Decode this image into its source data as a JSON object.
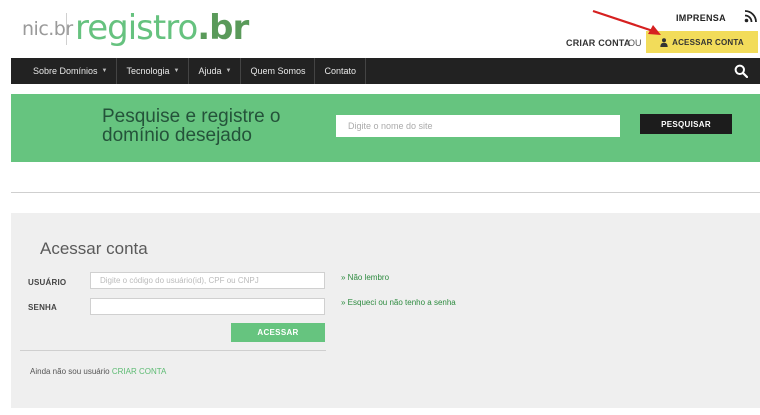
{
  "header": {
    "logo_nic": "nic.br",
    "logo_registro": "registro",
    "logo_br": ".br",
    "imprensa": "IMPRENSA",
    "criar_conta": "CRIAR CONTA",
    "ou": "OU",
    "acessar_conta": "ACESSAR CONTA"
  },
  "nav": {
    "items": [
      {
        "label": "Sobre Domínios",
        "caret": "▼"
      },
      {
        "label": "Tecnologia",
        "caret": "▼"
      },
      {
        "label": "Ajuda",
        "caret": "▼"
      },
      {
        "label": "Quem Somos",
        "caret": ""
      },
      {
        "label": "Contato",
        "caret": ""
      }
    ]
  },
  "search": {
    "title": "Pesquise e registre o domínio desejado",
    "placeholder": "Digite o nome do site",
    "button": "PESQUISAR"
  },
  "login": {
    "title": "Acessar conta",
    "user_label": "USUÁRIO",
    "user_placeholder": "Digite o código do usuário(id), CPF ou CNPJ",
    "pass_label": "SENHA",
    "forgot_link": "» Não lembro",
    "reset_link": "» Esqueci ou não tenho a senha",
    "submit": "ACESSAR",
    "not_user_text": "Ainda não sou usuário",
    "criar_conta": "CRIAR CONTA"
  },
  "colors": {
    "brand_green": "#66c47f",
    "nav_bg": "#222222",
    "highlight_yellow": "#f2dc5a",
    "annotation_arrow": "#d62020"
  }
}
